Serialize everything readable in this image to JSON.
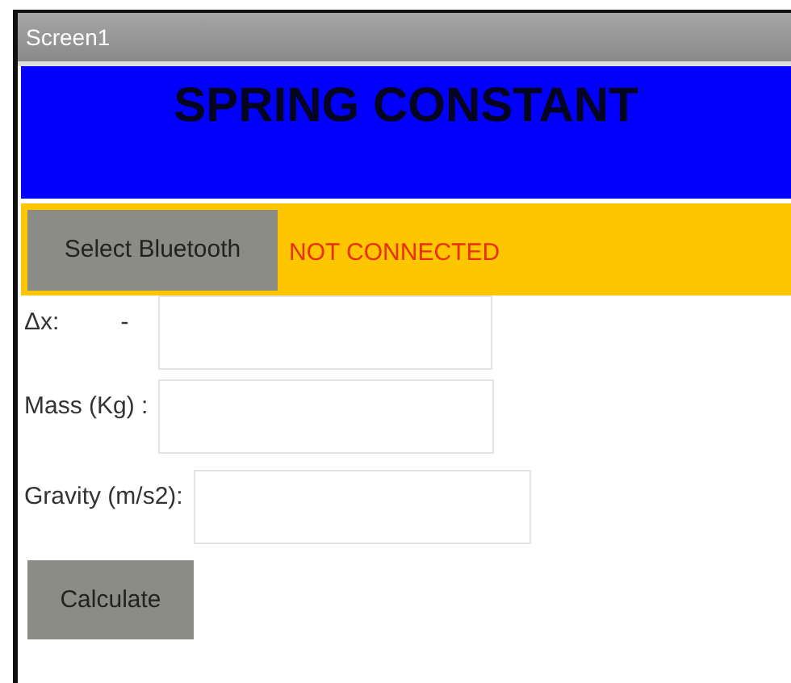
{
  "window": {
    "title": "Screen1"
  },
  "header": {
    "title": "SPRING CONSTANT"
  },
  "bluetooth": {
    "button": "Select Bluetooth",
    "status": "NOT CONNECTED"
  },
  "fields": [
    {
      "label": "Δx:",
      "suffix": "-"
    },
    {
      "label": "Mass (Kg) :"
    },
    {
      "label": "Gravity (m/s2):"
    }
  ],
  "buttons": [
    "Calculate"
  ]
}
